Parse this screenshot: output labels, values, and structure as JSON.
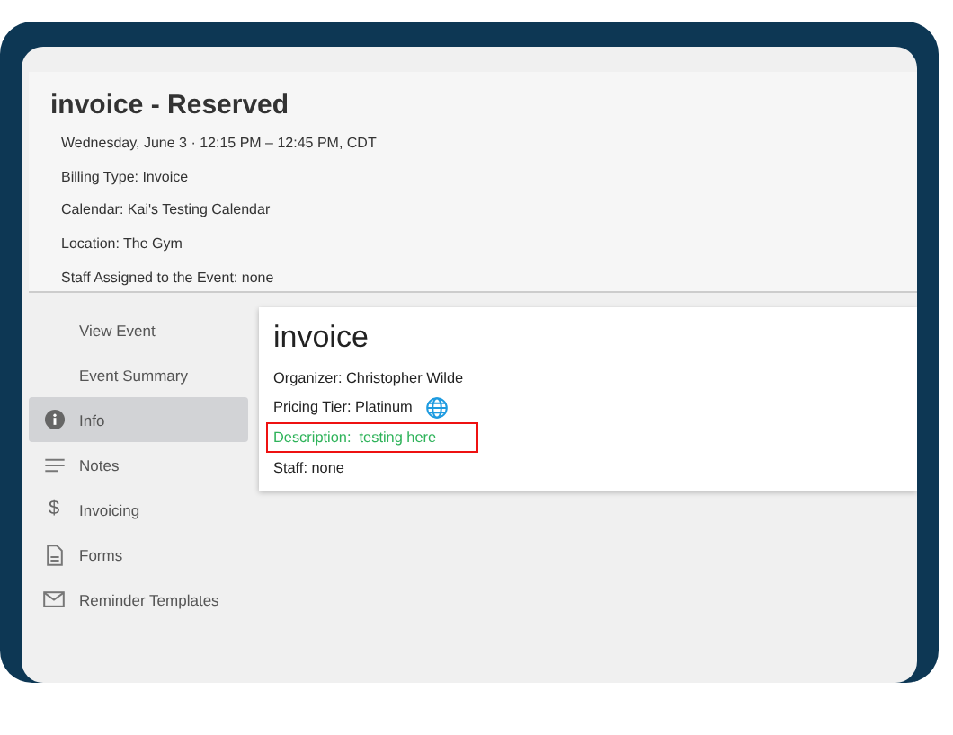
{
  "header": {
    "title": "invoice - Reserved",
    "details": [
      "Wednesday, June 3  ·  12:15 PM – 12:45 PM, CDT",
      "Billing Type: Invoice",
      "Calendar: Kai's Testing Calendar",
      "Location: The Gym",
      "Staff Assigned to the Event: none"
    ]
  },
  "sidebar": {
    "items": [
      {
        "label": "View Event",
        "kind": "plain",
        "selected": false
      },
      {
        "label": "Event Summary",
        "kind": "plain",
        "selected": false
      },
      {
        "label": "Info",
        "kind": "info",
        "selected": true
      },
      {
        "label": "Notes",
        "kind": "notes",
        "selected": false
      },
      {
        "label": "Invoicing",
        "kind": "dollar",
        "icon": "$",
        "selected": false
      },
      {
        "label": "Forms",
        "kind": "document",
        "selected": false
      },
      {
        "label": "Reminder Templates",
        "kind": "mail",
        "selected": false
      }
    ]
  },
  "card": {
    "title": "invoice",
    "lines": [
      {
        "text": "Organizer: Christopher Wilde",
        "kind": "plain",
        "highlighted": false
      },
      {
        "text": "Pricing Tier: Platinum",
        "kind": "globe",
        "highlighted": false
      },
      {
        "text": "Description:  testing here",
        "kind": "accent",
        "highlighted": true
      },
      {
        "text": "Staff: none",
        "kind": "plain",
        "highlighted": false
      }
    ]
  }
}
